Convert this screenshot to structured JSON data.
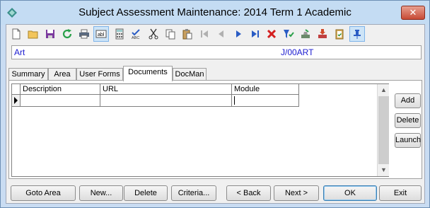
{
  "window": {
    "title": "Subject Assessment Maintenance:  2014 Term 1 Academic",
    "close_label": "✕"
  },
  "toolbar": {
    "icons": [
      "new-document-icon",
      "open-folder-icon",
      "save-icon",
      "refresh-icon",
      "print-icon",
      "field-icon",
      "calculator-icon",
      "spellcheck-icon",
      "cut-icon",
      "copy-icon",
      "paste-icon",
      "first-record-icon",
      "previous-record-icon",
      "next-record-icon",
      "last-record-icon",
      "delete-icon",
      "filter-icon",
      "stamp-icon",
      "inbox-download-icon",
      "clipboard-check-icon",
      "pin-icon"
    ]
  },
  "record": {
    "name": "Art",
    "code": "J/00ART"
  },
  "tabs": [
    {
      "label": "Summary"
    },
    {
      "label": "Area"
    },
    {
      "label": "User Forms"
    },
    {
      "label": "Documents"
    },
    {
      "label": "DocMan"
    }
  ],
  "grid": {
    "columns": [
      "Description",
      "URL",
      "Module"
    ],
    "rows": [
      [
        "",
        "",
        ""
      ]
    ]
  },
  "side_buttons": {
    "add": "Add",
    "delete": "Delete",
    "launch": "Launch"
  },
  "bottom_buttons": {
    "goto_area": "Goto Area",
    "new": "New...",
    "delete": "Delete",
    "criteria": "Criteria...",
    "back": "< Back",
    "next": "Next >",
    "ok": "OK",
    "exit": "Exit"
  }
}
